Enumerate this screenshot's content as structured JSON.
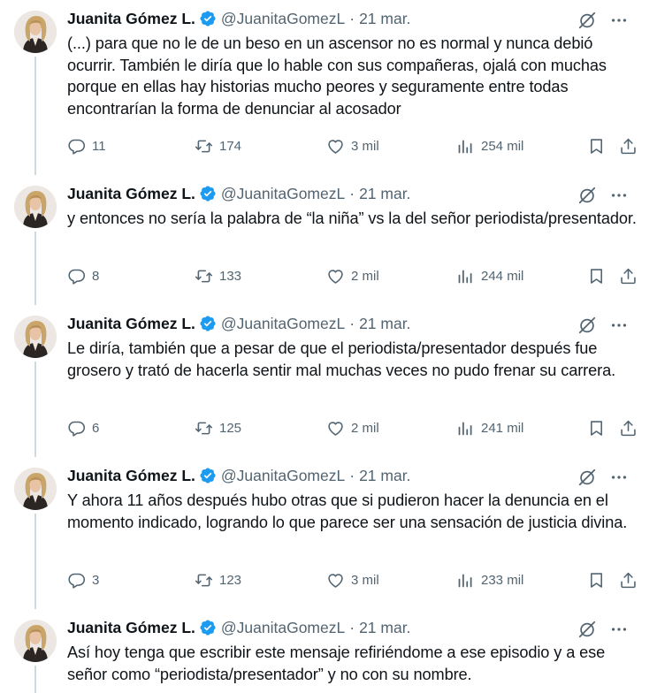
{
  "colors": {
    "text": "#0f1419",
    "muted": "#536471",
    "verified": "#1d9bf0",
    "thread_line": "#cfd9de"
  },
  "icons": [
    "reply-icon",
    "retweet-icon",
    "like-icon",
    "views-icon",
    "bookmark-icon",
    "share-icon",
    "grok-icon",
    "more-icon",
    "verified-badge-icon"
  ],
  "tweets": [
    {
      "name": "Juanita Gómez L.",
      "handle": "@JuanitaGomezL",
      "separator": "·",
      "date": "21 mar.",
      "text": "(...) para que no le de un beso en un ascensor no es normal y nunca debió ocurrir. También le diría que lo hable con sus compañeras, ojalá con muchas porque en ellas hay historias mucho peores y seguramente entre todas encontrarían la forma de denunciar al acosador",
      "replies": "11",
      "retweets": "174",
      "likes": "3 mil",
      "views": "254 mil"
    },
    {
      "name": "Juanita Gómez L.",
      "handle": "@JuanitaGomezL",
      "separator": "·",
      "date": "21 mar.",
      "text": "y entonces no sería la palabra de “la niña” vs la del señor periodista/presentador.",
      "replies": "8",
      "retweets": "133",
      "likes": "2 mil",
      "views": "244 mil"
    },
    {
      "name": "Juanita Gómez L.",
      "handle": "@JuanitaGomezL",
      "separator": "·",
      "date": "21 mar.",
      "text": "Le diría, también que a pesar de que el periodista/presentador después fue grosero y trató de hacerla sentir mal muchas veces no pudo frenar su carrera.",
      "replies": "6",
      "retweets": "125",
      "likes": "2 mil",
      "views": "241 mil"
    },
    {
      "name": "Juanita Gómez L.",
      "handle": "@JuanitaGomezL",
      "separator": "·",
      "date": "21 mar.",
      "text": "Y ahora 11 años después hubo otras que si pudieron hacer la denuncia en el momento indicado, logrando lo que parece ser una sensación de justicia divina.",
      "replies": "3",
      "retweets": "123",
      "likes": "3 mil",
      "views": "233 mil"
    },
    {
      "name": "Juanita Gómez L.",
      "handle": "@JuanitaGomezL",
      "separator": "·",
      "date": "21 mar.",
      "text": "Así hoy tenga que escribir este mensaje refiriéndome a ese episodio y a ese señor como “periodista/presentador” y no con su nombre."
    }
  ]
}
